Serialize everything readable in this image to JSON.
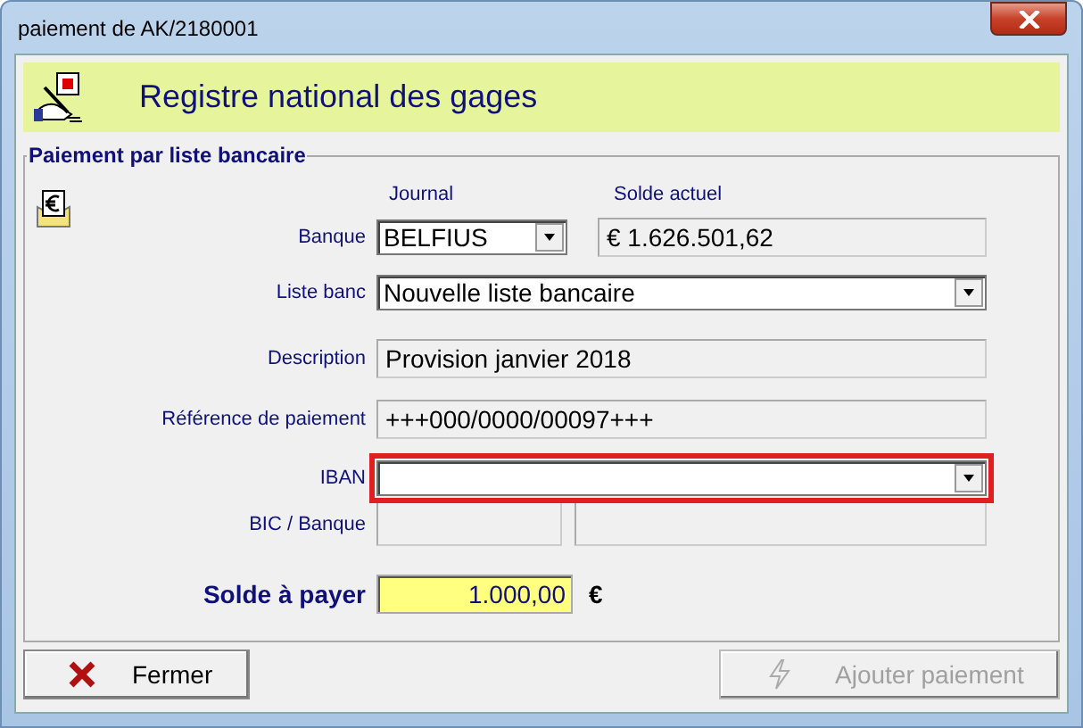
{
  "window": {
    "title": "paiement de AK/2180001"
  },
  "banner": {
    "title": "Registre national des gages"
  },
  "group": {
    "title": "Paiement par liste bancaire"
  },
  "column_headers": [
    "Journal",
    "Solde actuel"
  ],
  "rows": [
    {
      "kind": "pair",
      "label": "Banque",
      "combo": "BELFIUS",
      "value": "€ 1.626.501,62"
    },
    {
      "kind": "combo",
      "label": "Liste banc",
      "value": "Nouvelle liste bancaire",
      "highlighted": false
    },
    {
      "kind": "text",
      "label": "Description",
      "value": "Provision janvier 2018"
    },
    {
      "kind": "text",
      "label": "Référence de paiement",
      "value": "+++000/0000/00097+++"
    },
    {
      "kind": "combo",
      "label": "IBAN",
      "highlighted": true
    },
    {
      "kind": "split",
      "label": "BIC / Banque"
    }
  ],
  "balance": {
    "label": "Solde à payer",
    "value": "1.000,00",
    "currency": "€"
  },
  "buttons": [
    {
      "kind": "close",
      "label": "Fermer",
      "disabled": false
    },
    {
      "kind": "add",
      "label": "Ajouter paiement",
      "disabled": true
    }
  ]
}
